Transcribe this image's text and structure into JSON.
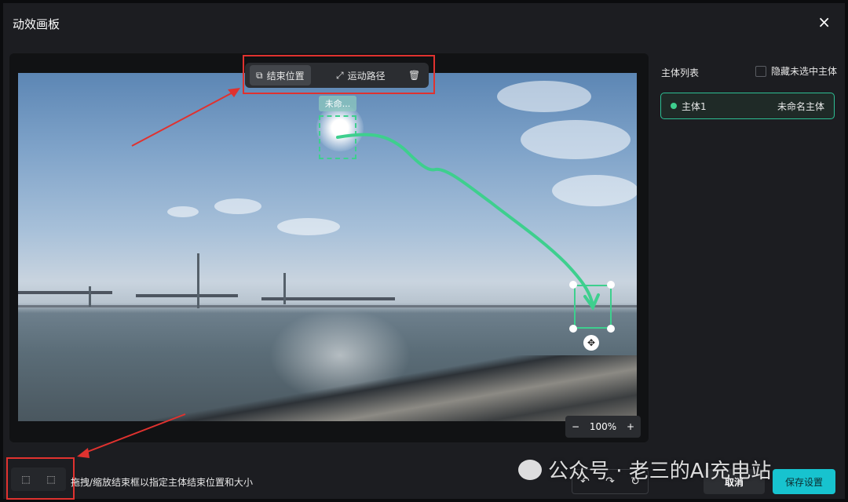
{
  "dialog": {
    "title": "动效画板",
    "close_icon": "×"
  },
  "toolbar": {
    "end_position_label": "结束位置",
    "motion_path_label": "运动路径",
    "end_position_icon": "⧉",
    "motion_path_icon": "⤢",
    "delete_icon": "🗑"
  },
  "canvas": {
    "subject_tag": "未命...",
    "zoom_level": "100%",
    "zoom_out": "−",
    "zoom_in": "+"
  },
  "sidebar": {
    "title": "主体列表",
    "hide_unselected_label": "隐藏未选中主体",
    "subjects": [
      {
        "name": "主体1",
        "tag": "未命名主体"
      }
    ]
  },
  "footer": {
    "hint": "拖拽/缩放结束框以指定主体结束位置和大小",
    "cancel_label": "取消",
    "save_label": "保存设置",
    "undo_icon": "↶",
    "redo_icon": "↷",
    "reset_icon": "↻",
    "select_tool_icon": "⬚",
    "box_tool_icon": "⬚"
  },
  "watermark": {
    "text": "公众号 · 老三的AI充电站"
  },
  "colors": {
    "accent": "#3ecf8e",
    "annotation": "#e0322f",
    "save_button": "#17c3cf"
  }
}
